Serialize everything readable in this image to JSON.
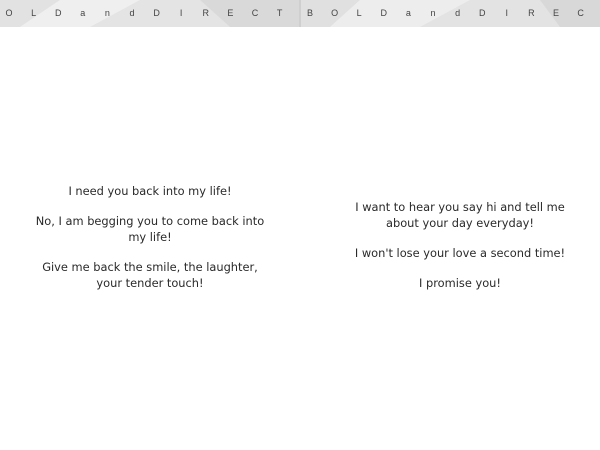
{
  "banner": {
    "left_letters": [
      "O",
      "L",
      "D",
      "a",
      "n",
      "d",
      "D",
      "I",
      "R",
      "E",
      "C",
      "T"
    ],
    "right_letters": [
      "B",
      "O",
      "L",
      "D",
      "a",
      "n",
      "d",
      "D",
      "I",
      "R",
      "E",
      "C"
    ],
    "background_color": "#e9e9e9"
  },
  "left_page": {
    "stanzas": [
      [
        "I need you back into my life!"
      ],
      [
        "No, I am begging you to come back into",
        "my life!"
      ],
      [
        "Give me back the smile, the laughter,",
        "your tender touch!"
      ]
    ]
  },
  "right_page": {
    "stanzas": [
      [
        "I want to hear you say hi and tell me",
        "about your day everyday!"
      ],
      [
        "I won't lose your love a second time!"
      ],
      [
        "I promise you!"
      ]
    ]
  }
}
